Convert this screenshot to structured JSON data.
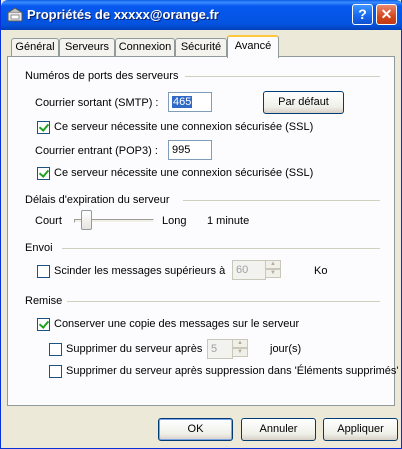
{
  "window": {
    "title": "Propriétés de xxxxx@orange.fr",
    "help_glyph": "?",
    "close_glyph": "✕"
  },
  "tabs": [
    {
      "label": "Général",
      "active": false
    },
    {
      "label": "Serveurs",
      "active": false
    },
    {
      "label": "Connexion",
      "active": false
    },
    {
      "label": "Sécurité",
      "active": false
    },
    {
      "label": "Avancé",
      "active": true
    }
  ],
  "ports": {
    "heading": "Numéros de ports des serveurs",
    "smtp_label": "Courrier sortant (SMTP) :",
    "smtp_value": "465",
    "default_button": "Par défaut",
    "smtp_ssl_label": "Ce serveur nécessite une connexion sécurisée (SSL)",
    "smtp_ssl_checked": true,
    "pop3_label": "Courrier entrant (POP3) :",
    "pop3_value": "995",
    "pop3_ssl_label": "Ce serveur nécessite une connexion sécurisée (SSL)",
    "pop3_ssl_checked": true
  },
  "timeout": {
    "heading": "Délais d'expiration du serveur",
    "short_label": "Court",
    "long_label": "Long",
    "value_text": "1 minute",
    "slider_level": 0.1
  },
  "send": {
    "heading": "Envoi",
    "split_label": "Scinder les messages supérieurs à",
    "split_checked": false,
    "split_value": "60",
    "split_unit": "Ko"
  },
  "delivery": {
    "heading": "Remise",
    "keep_copy_label": "Conserver une copie des messages sur le serveur",
    "keep_copy_checked": true,
    "remove_after_label": "Supprimer du serveur après",
    "remove_after_checked": false,
    "remove_after_value": "5",
    "remove_after_unit": "jour(s)",
    "remove_deleted_label": "Supprimer du serveur après suppression dans 'Éléments supprimés'",
    "remove_deleted_checked": false
  },
  "buttons": {
    "ok": "OK",
    "cancel": "Annuler",
    "apply": "Appliquer"
  },
  "colors": {
    "titlebar": "#0454e0",
    "face": "#ece9d8",
    "panel": "#fcfcfe",
    "tab_highlight": "#ffc83c",
    "check": "#21a121"
  }
}
